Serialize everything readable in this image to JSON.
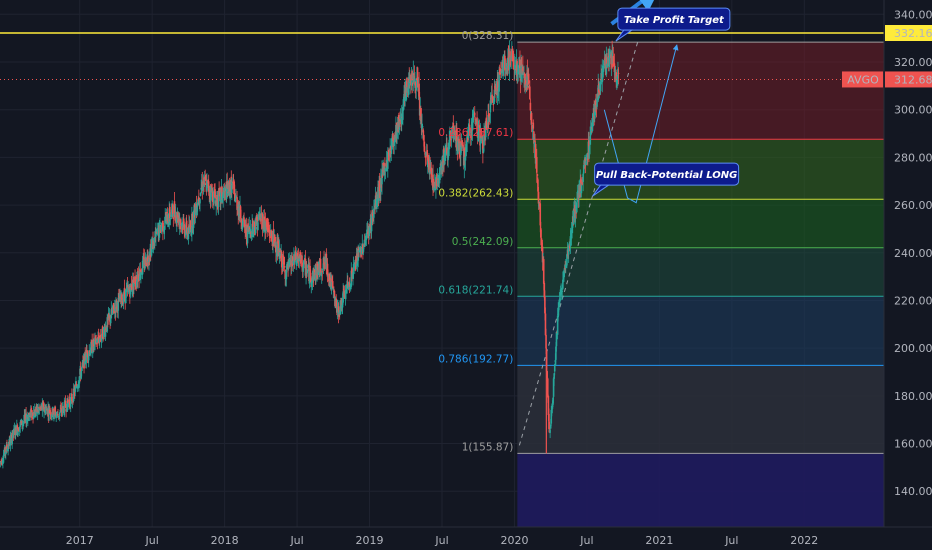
{
  "chart_data": {
    "type": "candlestick",
    "ticker": "AVGO",
    "ylim": [
      125,
      346
    ],
    "y_ticks": [
      "140.00",
      "160.00",
      "180.00",
      "200.00",
      "220.00",
      "240.00",
      "260.00",
      "280.00",
      "300.00",
      "320.00",
      "340.00"
    ],
    "y_tick_values": [
      140,
      160,
      180,
      200,
      220,
      240,
      260,
      280,
      300,
      320,
      340
    ],
    "x_tick_labels": [
      "2017",
      "Jul",
      "2018",
      "Jul",
      "2019",
      "Jul",
      "2020",
      "Jul",
      "2021",
      "Jul",
      "2022"
    ],
    "x_tick_dates": [
      2017.0,
      2017.5,
      2018.0,
      2018.5,
      2019.0,
      2019.5,
      2020.0,
      2020.5,
      2021.0,
      2021.5,
      2022.0
    ],
    "xlim": [
      2016.45,
      2022.55
    ],
    "last_price": {
      "label": "AVGO",
      "value": "312.68",
      "y": 312.68,
      "color": "#ef5350"
    },
    "target_line": {
      "value": "332.16",
      "y": 332.16,
      "color": "#ffeb3b"
    },
    "price_path": [
      [
        2016.45,
        152
      ],
      [
        2016.55,
        165
      ],
      [
        2016.65,
        172
      ],
      [
        2016.75,
        175
      ],
      [
        2016.85,
        172
      ],
      [
        2016.95,
        179
      ],
      [
        2017.05,
        198
      ],
      [
        2017.15,
        205
      ],
      [
        2017.25,
        218
      ],
      [
        2017.35,
        225
      ],
      [
        2017.45,
        236
      ],
      [
        2017.55,
        250
      ],
      [
        2017.65,
        258
      ],
      [
        2017.75,
        248
      ],
      [
        2017.85,
        270
      ],
      [
        2017.95,
        262
      ],
      [
        2018.05,
        268
      ],
      [
        2018.15,
        248
      ],
      [
        2018.25,
        255
      ],
      [
        2018.35,
        244
      ],
      [
        2018.42,
        232
      ],
      [
        2018.5,
        238
      ],
      [
        2018.6,
        230
      ],
      [
        2018.7,
        236
      ],
      [
        2018.78,
        215
      ],
      [
        2018.85,
        226
      ],
      [
        2018.92,
        238
      ],
      [
        2019.0,
        250
      ],
      [
        2019.08,
        270
      ],
      [
        2019.15,
        285
      ],
      [
        2019.22,
        298
      ],
      [
        2019.28,
        315
      ],
      [
        2019.33,
        310
      ],
      [
        2019.38,
        282
      ],
      [
        2019.45,
        268
      ],
      [
        2019.5,
        278
      ],
      [
        2019.58,
        290
      ],
      [
        2019.65,
        280
      ],
      [
        2019.72,
        298
      ],
      [
        2019.78,
        285
      ],
      [
        2019.85,
        305
      ],
      [
        2019.92,
        318
      ],
      [
        2019.97,
        322
      ],
      [
        2020.02,
        318
      ],
      [
        2020.1,
        310
      ],
      [
        2020.14,
        284
      ],
      [
        2020.17,
        260
      ],
      [
        2020.2,
        232
      ],
      [
        2020.22,
        195
      ],
      [
        2020.24,
        165
      ],
      [
        2020.26,
        175
      ],
      [
        2020.3,
        215
      ],
      [
        2020.35,
        235
      ],
      [
        2020.42,
        258
      ],
      [
        2020.5,
        280
      ],
      [
        2020.55,
        300
      ],
      [
        2020.62,
        318
      ],
      [
        2020.67,
        322
      ],
      [
        2020.72,
        312
      ]
    ],
    "fibonacci": {
      "from_date": 2020.02,
      "levels": [
        {
          "ratio": "0",
          "value": 328.31,
          "label": "0(328.31)",
          "color": "#9e9e9e",
          "fill": "#7a1e25",
          "fill_opacity": 0.5
        },
        {
          "ratio": "0.236",
          "value": 287.61,
          "label": "0.236(287.61)",
          "color": "#f23645",
          "fill": "#33691e",
          "fill_opacity": 0.55
        },
        {
          "ratio": "0.382",
          "value": 262.43,
          "label": "0.382(262.43)",
          "color": "#cddc39",
          "fill": "#1b5e20",
          "fill_opacity": 0.6
        },
        {
          "ratio": "0.5",
          "value": 242.09,
          "label": "0.5(242.09)",
          "color": "#4caf50",
          "fill": "#1e4d3c",
          "fill_opacity": 0.55
        },
        {
          "ratio": "0.618",
          "value": 221.74,
          "label": "0.618(221.74)",
          "color": "#26a69a",
          "fill": "#1c3b5c",
          "fill_opacity": 0.6
        },
        {
          "ratio": "0.786",
          "value": 192.77,
          "label": "0.786(192.77)",
          "color": "#2196f3",
          "fill": "#2b2f3a",
          "fill_opacity": 0.85
        },
        {
          "ratio": "1",
          "value": 155.87,
          "label": "1(155.87)",
          "color": "#9e9e9e",
          "fill": "#1f1b5e",
          "fill_opacity": 0.9
        }
      ]
    },
    "annotations": [
      {
        "text": "Take Profit Target",
        "anchor_date": 2021.1,
        "anchor_value": 338
      },
      {
        "text": "Pull Back-Potential LONG",
        "anchor_date": 2021.05,
        "anchor_value": 273
      }
    ]
  }
}
